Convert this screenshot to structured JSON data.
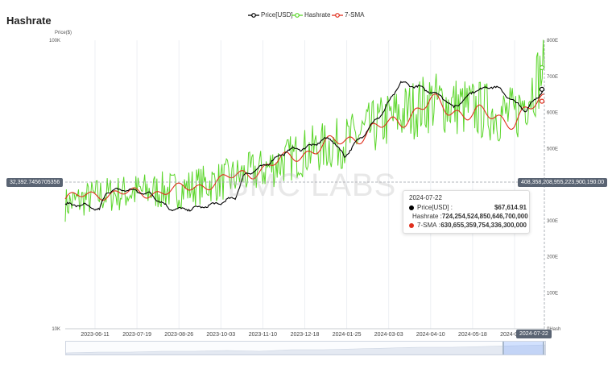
{
  "title": "Hashrate",
  "watermark": "BMC LABS",
  "legend": [
    {
      "name": "Price[USD]",
      "color": "#000000"
    },
    {
      "name": "Hashrate",
      "color": "#5bd62a"
    },
    {
      "name": "7-SMA",
      "color": "#e0301e"
    }
  ],
  "crosshair": {
    "left_label": "32,392.7456705356",
    "right_label": "408,358,208,955,223,900,190.00",
    "x_label": "2024-07-22"
  },
  "tooltip": {
    "date": "2024-07-22",
    "rows": [
      {
        "label": "Price[USD] :",
        "value": "$67,614.91",
        "color": "#000000"
      },
      {
        "label": "Hashrate :",
        "value": "724,254,524,850,646,700,000",
        "color": "#5bd62a"
      },
      {
        "label": "7-SMA :",
        "value": "630,655,359,754,336,300,000",
        "color": "#e0301e"
      }
    ]
  },
  "chart_data": {
    "type": "line",
    "x_ticks": [
      "2023-06-11",
      "2023-07-19",
      "2023-08-26",
      "2023-10-03",
      "2023-11-10",
      "2023-12-18",
      "2024-01-25",
      "2024-03-03",
      "2024-04-10",
      "2024-05-18",
      "2024-06-25"
    ],
    "x_range": [
      "2023-05-15",
      "2024-07-22"
    ],
    "left_axis": {
      "label": "Price($)",
      "scale": "log",
      "range": [
        10000,
        100000
      ],
      "ticks": [
        "10K",
        "100K"
      ]
    },
    "right_axis": {
      "range": [
        0,
        800
      ],
      "unit": "E",
      "ticks": [
        "0Hash",
        "100E",
        "200E",
        "300E",
        "400E",
        "500E",
        "600E",
        "700E",
        "800E"
      ]
    },
    "grid": "vertical",
    "series": [
      {
        "name": "Price[USD]",
        "axis": "left",
        "color": "#000000",
        "x": [
          "2023-05-15",
          "2023-06-01",
          "2023-06-15",
          "2023-06-22",
          "2023-07-10",
          "2023-08-01",
          "2023-08-17",
          "2023-09-01",
          "2023-09-15",
          "2023-10-01",
          "2023-10-16",
          "2023-10-24",
          "2023-11-10",
          "2023-12-05",
          "2023-12-18",
          "2024-01-10",
          "2024-01-23",
          "2024-02-10",
          "2024-02-28",
          "2024-03-14",
          "2024-04-01",
          "2024-04-20",
          "2024-05-01",
          "2024-05-20",
          "2024-06-07",
          "2024-06-25",
          "2024-07-05",
          "2024-07-22"
        ],
        "values": [
          27000,
          26800,
          25800,
          30000,
          30400,
          29200,
          26100,
          25900,
          26400,
          27200,
          28500,
          34000,
          36500,
          41900,
          42200,
          46000,
          39500,
          47500,
          57000,
          71300,
          68500,
          64000,
          58200,
          67000,
          69500,
          61000,
          57000,
          67615
        ]
      },
      {
        "name": "Hashrate",
        "axis": "right",
        "unit": "EH/s",
        "color": "#5bd62a",
        "x": [
          "2023-05-15",
          "2023-06-15",
          "2023-07-19",
          "2023-08-26",
          "2023-10-03",
          "2023-11-10",
          "2023-12-18",
          "2024-01-25",
          "2024-03-03",
          "2024-04-10",
          "2024-05-18",
          "2024-06-25",
          "2024-07-22"
        ],
        "values": [
          345,
          370,
          380,
          385,
          410,
          440,
          490,
          520,
          580,
          630,
          610,
          590,
          724
        ]
      },
      {
        "name": "7-SMA",
        "axis": "right",
        "unit": "EH/s",
        "color": "#e0301e",
        "x": [
          "2023-05-15",
          "2023-06-15",
          "2023-07-19",
          "2023-08-26",
          "2023-10-03",
          "2023-11-10",
          "2023-12-18",
          "2024-01-25",
          "2024-03-03",
          "2024-04-10",
          "2024-05-18",
          "2024-06-25",
          "2024-07-22"
        ],
        "values": [
          360,
          375,
          375,
          385,
          410,
          445,
          490,
          525,
          565,
          625,
          595,
          580,
          631
        ]
      }
    ]
  }
}
